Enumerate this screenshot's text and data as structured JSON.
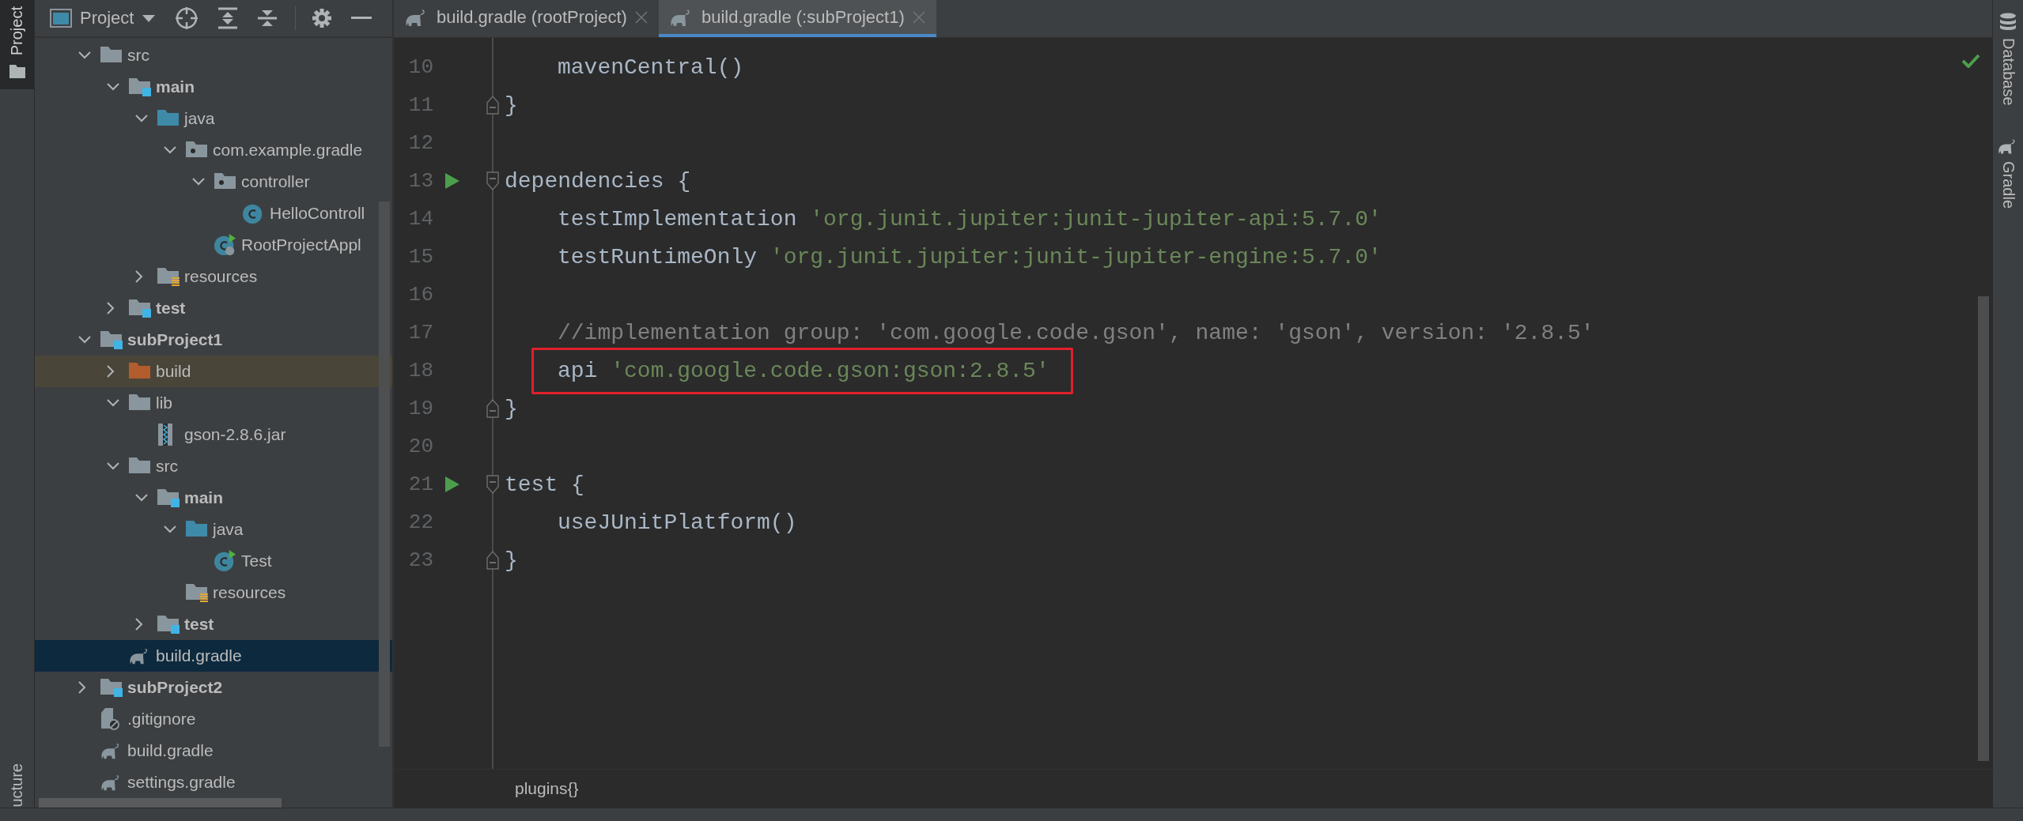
{
  "left_stripe": [
    {
      "label": "Project",
      "selected": true
    },
    {
      "label": "ucture",
      "selected": false
    }
  ],
  "project_panel": {
    "title": "Project"
  },
  "tree": {
    "items": [
      {
        "label": "src",
        "kind": "folder",
        "expanded": true,
        "selected": false,
        "children": [
          {
            "label": "main",
            "kind": "module",
            "expanded": true,
            "selected": false,
            "children": [
              {
                "label": "java",
                "kind": "source",
                "expanded": true,
                "selected": false,
                "children": [
                  {
                    "label": "com.example.gradle",
                    "kind": "package",
                    "expanded": true,
                    "selected": false,
                    "children": [
                      {
                        "label": "controller",
                        "kind": "package",
                        "expanded": true,
                        "selected": false,
                        "children": [
                          {
                            "label": "HelloControll",
                            "kind": "class",
                            "selected": false
                          }
                        ]
                      },
                      {
                        "label": "RootProjectAppl",
                        "kind": "app-class",
                        "selected": false
                      }
                    ]
                  }
                ]
              },
              {
                "label": "resources",
                "kind": "resources",
                "expanded": false,
                "selected": false
              }
            ]
          },
          {
            "label": "test",
            "kind": "module",
            "expanded": false,
            "selected": false
          }
        ]
      },
      {
        "label": "subProject1",
        "kind": "module",
        "expanded": true,
        "selected": false,
        "children": [
          {
            "label": "build",
            "kind": "excluded",
            "expanded": false,
            "selected": false
          },
          {
            "label": "lib",
            "kind": "folder",
            "expanded": true,
            "selected": false,
            "children": [
              {
                "label": "gson-2.8.6.jar",
                "kind": "jar",
                "selected": false
              }
            ]
          },
          {
            "label": "src",
            "kind": "folder",
            "expanded": true,
            "selected": false,
            "children": [
              {
                "label": "main",
                "kind": "module",
                "expanded": true,
                "selected": false,
                "children": [
                  {
                    "label": "java",
                    "kind": "source",
                    "expanded": true,
                    "selected": false,
                    "children": [
                      {
                        "label": "Test",
                        "kind": "runnable-class",
                        "selected": false
                      }
                    ]
                  },
                  {
                    "label": "resources",
                    "kind": "resources",
                    "selected": false
                  }
                ]
              },
              {
                "label": "test",
                "kind": "module",
                "expanded": false,
                "selected": false
              }
            ]
          },
          {
            "label": "build.gradle",
            "kind": "gradle",
            "selected": true
          }
        ]
      },
      {
        "label": "subProject2",
        "kind": "module",
        "expanded": false,
        "selected": false
      },
      {
        "label": ".gitignore",
        "kind": "gitignore",
        "selected": false
      },
      {
        "label": "build.gradle",
        "kind": "gradle",
        "selected": false
      },
      {
        "label": "settings.gradle",
        "kind": "gradle",
        "selected": false
      }
    ]
  },
  "tabs": [
    {
      "label": "build.gradle (rootProject)",
      "selected": false
    },
    {
      "label": "build.gradle (:subProject1)",
      "selected": true
    }
  ],
  "lines": [
    {
      "number": "10",
      "run": false,
      "boxed": false,
      "fold_start": false,
      "fold_end": false,
      "indented": true,
      "tokens": [
        {
          "kind": "plain",
          "text": "mavenCentral()"
        }
      ]
    },
    {
      "number": "11",
      "run": false,
      "boxed": false,
      "fold_start": false,
      "fold_end": true,
      "indented": false,
      "tokens": [
        {
          "kind": "plain",
          "text": "}"
        }
      ]
    },
    {
      "number": "12",
      "run": false,
      "boxed": false,
      "fold_start": false,
      "fold_end": false
    },
    {
      "number": "13",
      "run": true,
      "boxed": false,
      "fold_start": true,
      "fold_end": false,
      "indented": false,
      "tokens": [
        {
          "kind": "plain",
          "text": "dependencies {"
        }
      ]
    },
    {
      "number": "14",
      "run": false,
      "boxed": false,
      "fold_start": false,
      "fold_end": false,
      "indented": true,
      "tokens": [
        {
          "kind": "plain",
          "text": "testImplementation "
        },
        {
          "kind": "string",
          "text": "'org.junit.jupiter:junit-jupiter-api:5.7.0'"
        }
      ]
    },
    {
      "number": "15",
      "run": false,
      "boxed": false,
      "fold_start": false,
      "fold_end": false,
      "indented": true,
      "tokens": [
        {
          "kind": "plain",
          "text": "testRuntimeOnly "
        },
        {
          "kind": "string",
          "text": "'org.junit.jupiter:junit-jupiter-engine:5.7.0'"
        }
      ]
    },
    {
      "number": "16",
      "run": false,
      "boxed": false,
      "fold_start": false,
      "fold_end": false
    },
    {
      "number": "17",
      "run": false,
      "boxed": false,
      "fold_start": false,
      "fold_end": false,
      "indented": true,
      "tokens": [
        {
          "kind": "comment",
          "text": "//implementation group: 'com.google.code.gson', name: 'gson', version: '2.8.5'"
        }
      ]
    },
    {
      "number": "18",
      "run": false,
      "boxed": true,
      "fold_start": false,
      "fold_end": false,
      "indented": true,
      "tokens": [
        {
          "kind": "plain",
          "text": "api "
        },
        {
          "kind": "string",
          "text": "'com.google.code.gson:gson:2.8.5'"
        }
      ]
    },
    {
      "number": "19",
      "run": false,
      "boxed": false,
      "fold_start": false,
      "fold_end": true,
      "indented": false,
      "tokens": [
        {
          "kind": "plain",
          "text": "}"
        }
      ]
    },
    {
      "number": "20",
      "run": false,
      "boxed": false,
      "fold_start": false,
      "fold_end": false
    },
    {
      "number": "21",
      "run": true,
      "boxed": false,
      "fold_start": true,
      "fold_end": false,
      "indented": false,
      "tokens": [
        {
          "kind": "plain",
          "text": "test {"
        }
      ]
    },
    {
      "number": "22",
      "run": false,
      "boxed": false,
      "fold_start": false,
      "fold_end": false,
      "indented": true,
      "tokens": [
        {
          "kind": "plain",
          "text": "useJUnitPlatform()"
        }
      ]
    },
    {
      "number": "23",
      "run": false,
      "boxed": false,
      "fold_start": false,
      "fold_end": true,
      "indented": false,
      "tokens": [
        {
          "kind": "plain",
          "text": "}"
        }
      ]
    }
  ],
  "breadcrumb": "plugins{}",
  "right_stripe": [
    {
      "label": "Database",
      "kind": "database"
    },
    {
      "label": "Gradle",
      "kind": "gradle"
    }
  ]
}
